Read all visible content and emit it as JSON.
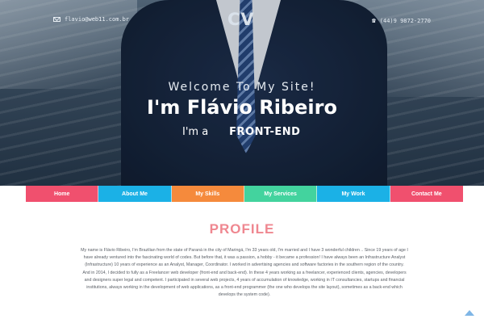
{
  "header": {
    "email": "flavio@web11.com.br",
    "phone": "(44)9 9872-2770",
    "logo": "CV",
    "welcome": "Welcome To My Site!",
    "name": "I'm Flávio Ribeiro",
    "role_prefix": "I'm a",
    "role_word": "FRONT-END"
  },
  "nav": {
    "items": [
      {
        "label": "Home",
        "color": "#f0506e"
      },
      {
        "label": "About Me",
        "color": "#1bb1e6"
      },
      {
        "label": "My Skills",
        "color": "#f58a3c"
      },
      {
        "label": "My Services",
        "color": "#43d39e"
      },
      {
        "label": "My Work",
        "color": "#1bb1e6"
      },
      {
        "label": "Contact Me",
        "color": "#f0506e"
      }
    ]
  },
  "profile": {
    "title": "PROFILE",
    "text": "My name is Flávio Ribeiro, I'm Brazilian from the state of Paraná in the city of Maringá, I'm 33 years old, I'm married and I have 3 wonderful children .. Since 19 years of age I have already ventured into the fascinating world of codes. But before that, it was a passion, a hobby - it became a profession! I have always been an Infrastructure Analyst (Infrastructure) 10 years of experience as an Analyst, Manager, Coordinator. I worked in advertising agencies and software factories in the southern region of the country. And in 2014, I decided to fully as a Freelancer web developer (front-end and back-end). In these 4 years working as a freelancer, experienced clients, agencies, developers and designers super legal and competent. I participated in several web projects, 4 years of accumulation of knowledge, working in IT consultancies, startups and financial institutions, always working in the development of web applications, as a front-end programmer (the one who develops the site layout), sometimes as a back-end which develops the system code)."
  },
  "icons": {
    "email": "mail-icon",
    "phone": "phone-icon",
    "scroll_top": "arrow-up-icon"
  }
}
